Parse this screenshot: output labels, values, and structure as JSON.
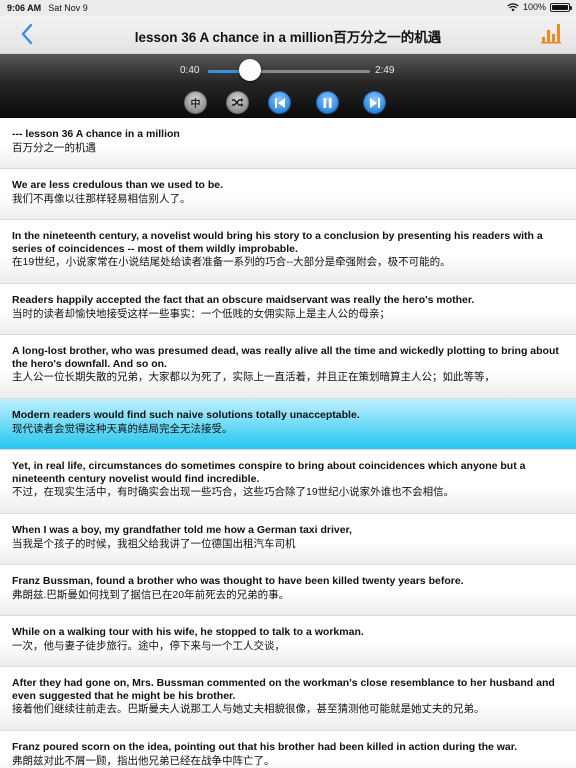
{
  "status": {
    "time": "9:06 AM",
    "date": "Sat Nov 9",
    "battery": "100%",
    "battery_level": 1.0
  },
  "nav": {
    "title": "lesson 36  A chance in a million百万分之一的机遇"
  },
  "player": {
    "elapsed": "0:40",
    "duration": "2:49",
    "progress": 0.26,
    "language_toggle": "中"
  },
  "sentences": [
    {
      "en": "--- lesson 36  A chance in a million",
      "zh": "百万分之一的机遇"
    },
    {
      "en": "We are less credulous than we used to be.",
      "zh": "我们不再像以往那样轻易相信别人了。"
    },
    {
      "en": "In the nineteenth century, a novelist would bring his story to a conclusion by presenting his readers with a series of coincidences -- most of them wildly improbable.",
      "zh": "在19世纪，小说家常在小说结尾处给读者准备一系列的巧合--大部分是牵强附会，极不可能的。"
    },
    {
      "en": "Readers happily accepted the fact that an obscure maidservant was really the hero's mother.",
      "zh": "当时的读者却愉快地接受这样一些事实：一个低贱的女佣实际上是主人公的母亲；"
    },
    {
      "en": "A long-lost brother, who was presumed dead, was really alive all the time and wickedly plotting to bring about the hero's downfall. And so on.",
      "zh": "主人公一位长期失散的兄弟，大家都以为死了，实际上一直活着，并且正在策划暗算主人公；如此等等，"
    },
    {
      "en": "Modern readers would find such naive solutions totally unacceptable.",
      "zh": "现代读者会觉得这种天真的结局完全无法接受。",
      "active": true
    },
    {
      "en": "Yet, in real life, circumstances do sometimes conspire to bring about coincidences which anyone but a nineteenth century novelist would find incredible.",
      "zh": "不过，在现实生活中，有时确实会出现一些巧合，这些巧合除了19世纪小说家外谁也不会相信。"
    },
    {
      "en": "When I was a boy, my grandfather told me how a German taxi driver,",
      "zh": "当我是个孩子的时候，我祖父给我讲了一位德国出租汽车司机"
    },
    {
      "en": "Franz Bussman, found a brother who was thought to have been killed twenty years before.",
      "zh": "弗朗兹.巴斯曼如何找到了据信已在20年前死去的兄弟的事。"
    },
    {
      "en": "While on a walking tour with his wife, he stopped to talk to a workman.",
      "zh": "一次，他与妻子徒步旅行。途中，停下来与一个工人交谈，"
    },
    {
      "en": "After they had gone on, Mrs. Bussman commented on the workman's close resemblance to her husband and even suggested that he might be his brother.",
      "zh": "接着他们继续往前走去。巴斯曼夫人说那工人与她丈夫相貌很像，甚至猜测他可能就是她丈夫的兄弟。"
    },
    {
      "en": "Franz poured scorn on the idea, pointing out that his brother had been killed in action during the war.",
      "zh": "弗朗兹对此不屑一顾，指出他兄弟已经在战争中阵亡了。"
    }
  ]
}
